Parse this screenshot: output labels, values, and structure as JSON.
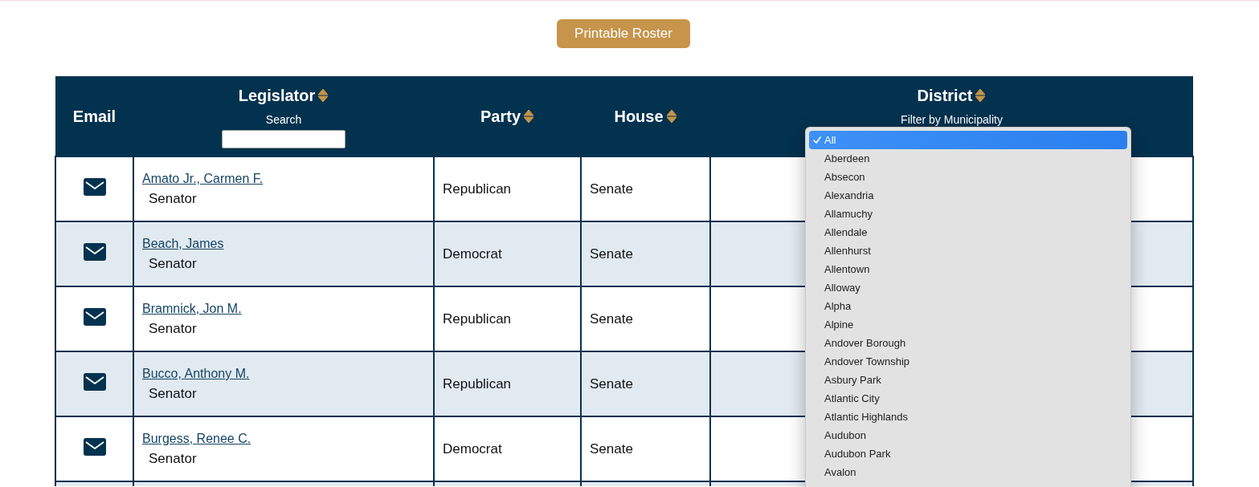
{
  "toolbar": {
    "button": "Printable Roster"
  },
  "table": {
    "columns": [
      {
        "label": "Email",
        "sortable": false
      },
      {
        "label": "Legislator",
        "sortable": true,
        "filter": {
          "kind": "search",
          "label": "Search"
        }
      },
      {
        "label": "Party",
        "sortable": true
      },
      {
        "label": "House",
        "sortable": true
      },
      {
        "label": "District",
        "sortable": true,
        "filter": {
          "kind": "select",
          "label": "Filter by Municipality",
          "expanded": true,
          "options": [
            {
              "label": "All",
              "selected": true
            },
            {
              "label": "Aberdeen",
              "selected": false
            },
            {
              "label": "Absecon",
              "selected": false
            },
            {
              "label": "Alexandria",
              "selected": false
            },
            {
              "label": "Allamuchy",
              "selected": false
            },
            {
              "label": "Allendale",
              "selected": false
            },
            {
              "label": "Allenhurst",
              "selected": false
            },
            {
              "label": "Allentown",
              "selected": false
            },
            {
              "label": "Alloway",
              "selected": false
            },
            {
              "label": "Alpha",
              "selected": false
            },
            {
              "label": "Alpine",
              "selected": false
            },
            {
              "label": "Andover Borough",
              "selected": false
            },
            {
              "label": "Andover Township",
              "selected": false
            },
            {
              "label": "Asbury Park",
              "selected": false
            },
            {
              "label": "Atlantic City",
              "selected": false
            },
            {
              "label": "Atlantic Highlands",
              "selected": false
            },
            {
              "label": "Audubon",
              "selected": false
            },
            {
              "label": "Audubon Park",
              "selected": false
            },
            {
              "label": "Avalon",
              "selected": false
            }
          ]
        }
      }
    ],
    "rows": [
      {
        "name": "Amato Jr., Carmen F.",
        "title": "Senator",
        "party": "Republican",
        "house": "Senate"
      },
      {
        "name": "Beach, James",
        "title": "Senator",
        "party": "Democrat",
        "house": "Senate"
      },
      {
        "name": "Bramnick, Jon M.",
        "title": "Senator",
        "party": "Republican",
        "house": "Senate"
      },
      {
        "name": "Bucco, Anthony M.",
        "title": "Senator",
        "party": "Republican",
        "house": "Senate"
      },
      {
        "name": "Burgess, Renee C.",
        "title": "Senator",
        "party": "Democrat",
        "house": "Senate"
      }
    ]
  }
}
